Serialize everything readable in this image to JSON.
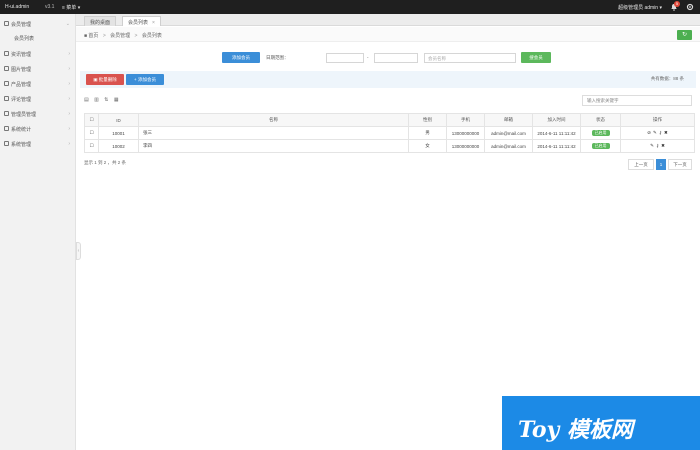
{
  "topbar": {
    "brand": "H-ui.admin",
    "version": "v3.1",
    "menu": "≡ 菜单 ▾",
    "user": "超级管理员  admin ▾",
    "badge": "5"
  },
  "sidebar": {
    "items": [
      {
        "label": "会员管理",
        "icon": "user-icon"
      },
      {
        "label": "会员列表",
        "icon": ""
      },
      {
        "label": "资讯管理",
        "icon": "news-icon"
      },
      {
        "label": "图片管理",
        "icon": "image-icon"
      },
      {
        "label": "产品管理",
        "icon": "product-icon"
      },
      {
        "label": "评论管理",
        "icon": "comment-icon"
      },
      {
        "label": "管理员管理",
        "icon": "admin-icon"
      },
      {
        "label": "系统统计",
        "icon": "stats-icon"
      },
      {
        "label": "系统管理",
        "icon": "settings-icon"
      }
    ]
  },
  "tabs": [
    {
      "label": "我的桌面"
    },
    {
      "label": "会员列表"
    }
  ],
  "breadcrumb": {
    "home": "首页",
    "level1": "会员管理",
    "level2": "会员列表"
  },
  "search": {
    "button_label": "添加会员",
    "date_label": "日期范围：",
    "date_from_placeholder": "",
    "date_to_placeholder": "",
    "date_sep": "-",
    "keyword_placeholder": "会员名称",
    "submit_label": "搜会员"
  },
  "actions": {
    "batch_delete": "批量删除",
    "add": "添加会员",
    "total_text": "共有数据：88 条"
  },
  "toolbar": {
    "icons": [
      "显示",
      "列",
      "排序",
      "导出"
    ],
    "table_search_placeholder": "输入搜索关键字"
  },
  "table": {
    "headers": [
      "",
      "ID",
      "名称",
      "性别",
      "手机",
      "邮箱",
      "加入时间",
      "状态",
      "操作"
    ],
    "rows": [
      {
        "id": "10001",
        "name": "张三",
        "gender": "男",
        "phone": "13000000000",
        "email": "admin@mail.com",
        "date": "2014-6-11 11:11:42",
        "status": "已启用"
      },
      {
        "id": "10002",
        "name": "李四",
        "gender": "女",
        "phone": "13000000000",
        "email": "admin@mail.com",
        "date": "2014-6-11 11:11:42",
        "status": "已启用"
      }
    ]
  },
  "pagination": {
    "info": "显示 1 到 2 ，共 2 条",
    "prev": "上一页",
    "current": "1",
    "next": "下一页"
  },
  "watermark": {
    "text": "Toy 模板网"
  },
  "colors": {
    "topbar": "#1f1f1f",
    "primary": "#3b8ed8",
    "danger": "#d9534f",
    "success": "#5cb85c",
    "watermark": "#1c8ae6"
  }
}
